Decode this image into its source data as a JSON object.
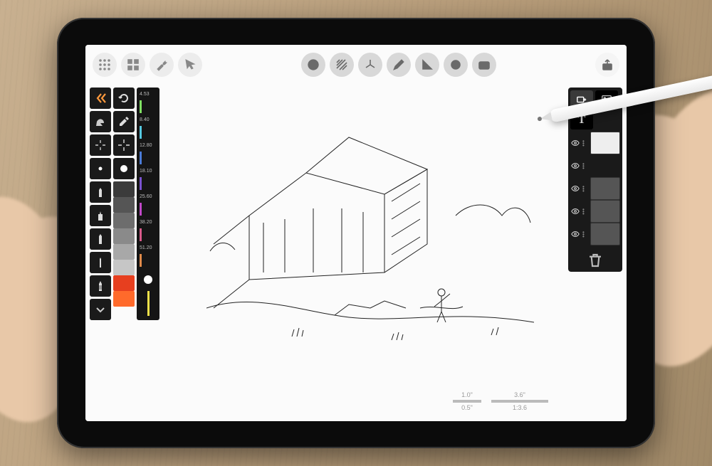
{
  "topbar": {
    "left": [
      {
        "name": "grid-dots-icon"
      },
      {
        "name": "grid-squares-icon"
      },
      {
        "name": "wrench-icon"
      },
      {
        "name": "arrow-cursor-icon"
      }
    ],
    "center": [
      {
        "name": "globe-3d-icon"
      },
      {
        "name": "hatch-icon"
      },
      {
        "name": "axes-icon"
      },
      {
        "name": "pencil-icon"
      },
      {
        "name": "ruler-triangle-icon"
      },
      {
        "name": "circle-target-icon"
      },
      {
        "name": "camera-icon"
      }
    ],
    "right": [
      {
        "name": "share-icon"
      }
    ]
  },
  "left_tools": {
    "row_top": [
      {
        "name": "collapse-arrows-icon"
      },
      {
        "name": "redo-circle-icon"
      }
    ],
    "row_undo": [
      {
        "name": "undo-stroke-icon"
      },
      {
        "name": "eyedropper-icon"
      }
    ],
    "row_target": [
      {
        "name": "aim-small-icon"
      },
      {
        "name": "aim-large-icon"
      }
    ],
    "sizes": [
      {
        "name": "brush-dot-small-icon"
      },
      {
        "name": "brush-dot-large-icon"
      }
    ],
    "brushes": [
      {
        "name": "brush-liner-icon"
      },
      {
        "name": "brush-marker-icon"
      },
      {
        "name": "brush-pencil-icon"
      },
      {
        "name": "brush-pen-icon"
      },
      {
        "name": "brush-expand-icon"
      }
    ],
    "swatches": [
      "#3b3b3b",
      "#555555",
      "#6d6d6d",
      "#8a8a8a",
      "#a8a8a8",
      "#c6c6c6",
      "#e73f1f",
      "#ff6a2b"
    ],
    "ruler_ticks": [
      "4.53",
      "8.40",
      "12.80",
      "18.10",
      "25.60",
      "38.20",
      "51.20"
    ]
  },
  "right_panel": {
    "top_buttons": [
      {
        "name": "add-layer-icon",
        "label": ""
      },
      {
        "name": "image-icon",
        "label": ""
      },
      {
        "name": "text-tool-icon",
        "label": "T"
      }
    ],
    "layers": [
      {
        "name": "layer-1",
        "kind": "white"
      },
      {
        "name": "layer-2",
        "kind": "sketch"
      },
      {
        "name": "layer-3",
        "kind": "grey"
      },
      {
        "name": "layer-4",
        "kind": "grey"
      },
      {
        "name": "layer-5",
        "kind": "grey"
      }
    ],
    "trash": {
      "name": "trash-icon"
    }
  },
  "scale": {
    "top1": "1.0\"",
    "bottom1": "0.5\"",
    "top2": "3.6\"",
    "bottom2": "1:3.6"
  }
}
